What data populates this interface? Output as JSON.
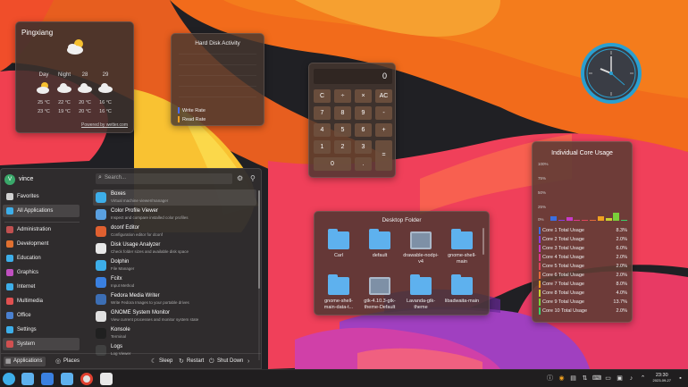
{
  "colors": {
    "accent": "#3daee9",
    "panel": "#463730",
    "write": "#4a6cf0",
    "read": "#f0a020"
  },
  "weather": {
    "city": "Pingxiang",
    "days": [
      {
        "label": "Day",
        "hi": "25 °C",
        "lo": "23 °C",
        "icon": "partly-sunny-icon"
      },
      {
        "label": "Night",
        "hi": "22 °C",
        "lo": "19 °C",
        "icon": "cloud-icon"
      },
      {
        "label": "28",
        "hi": "20 °C",
        "lo": "20 °C",
        "icon": "cloud-icon"
      },
      {
        "label": "29",
        "hi": "16 °C",
        "lo": "16 °C",
        "icon": "cloud-icon"
      }
    ],
    "powered": "Powered by wetter.com"
  },
  "disk": {
    "title": "Hard Disk Activity",
    "write_label": "Write Rate",
    "read_label": "Read Rate"
  },
  "calculator": {
    "display": "0",
    "keys": [
      "C",
      "÷",
      "×",
      "AC",
      "7",
      "8",
      "9",
      "-",
      "4",
      "5",
      "6",
      "+",
      "1",
      "2",
      "3",
      "=",
      "0",
      "."
    ]
  },
  "folder": {
    "title": "Desktop Folder",
    "items": [
      {
        "name": "Carl",
        "type": "folder"
      },
      {
        "name": "default",
        "type": "folder"
      },
      {
        "name": "drawable-nodpi-v4",
        "type": "image"
      },
      {
        "name": "gnome-shell-main",
        "type": "folder"
      },
      {
        "name": "gnome-shell-main-data-t...",
        "type": "folder"
      },
      {
        "name": "gtk-4.10.3-gtk-theme-Default",
        "type": "image"
      },
      {
        "name": "Lavanda-gtk-theme",
        "type": "folder"
      },
      {
        "name": "libadwaita-main",
        "type": "folder"
      }
    ]
  },
  "cores": {
    "title": "Individual Core Usage",
    "yticks": [
      "100%",
      "75%",
      "50%",
      "25%",
      "0%"
    ],
    "list": [
      {
        "name": "Core 1 Total Usage",
        "value": "8.3%",
        "pct": 8.3,
        "color": "#3b6fe0"
      },
      {
        "name": "Core 2 Total Usage",
        "value": "2.0%",
        "pct": 2.0,
        "color": "#8a3de0"
      },
      {
        "name": "Core 3 Total Usage",
        "value": "6.0%",
        "pct": 6.0,
        "color": "#c83ac8"
      },
      {
        "name": "Core 4 Total Usage",
        "value": "2.0%",
        "pct": 2.0,
        "color": "#e03a8a"
      },
      {
        "name": "Core 5 Total Usage",
        "value": "2.0%",
        "pct": 2.0,
        "color": "#e0455a"
      },
      {
        "name": "Core 6 Total Usage",
        "value": "2.0%",
        "pct": 2.0,
        "color": "#e06a3a"
      },
      {
        "name": "Core 7 Total Usage",
        "value": "8.0%",
        "pct": 8.0,
        "color": "#f0a020"
      },
      {
        "name": "Core 8 Total Usage",
        "value": "4.0%",
        "pct": 4.0,
        "color": "#c8d030"
      },
      {
        "name": "Core 9 Total Usage",
        "value": "13.7%",
        "pct": 13.7,
        "color": "#7ad03a"
      },
      {
        "name": "Core 10 Total Usage",
        "value": "2.0%",
        "pct": 2.0,
        "color": "#3ad06a"
      }
    ]
  },
  "launcher": {
    "user": "vince",
    "search_placeholder": "Search...",
    "avatar_letter": "V",
    "top_categories": [
      {
        "label": "Favorites",
        "color": "#d0d0d0"
      },
      {
        "label": "All Applications",
        "color": "#3daee9",
        "selected": true
      }
    ],
    "categories": [
      {
        "label": "Administration",
        "color": "#c05050"
      },
      {
        "label": "Development",
        "color": "#e07030"
      },
      {
        "label": "Education",
        "color": "#3daee9"
      },
      {
        "label": "Graphics",
        "color": "#c050c0"
      },
      {
        "label": "Internet",
        "color": "#3daee9"
      },
      {
        "label": "Multimedia",
        "color": "#e05050"
      },
      {
        "label": "Office",
        "color": "#4a80d0"
      },
      {
        "label": "Settings",
        "color": "#3daee9"
      },
      {
        "label": "System",
        "color": "#d05050"
      }
    ],
    "apps": [
      {
        "name": "Boxes",
        "desc": "Virtual machine viewer/manager",
        "color": "#3daee9",
        "selected": true
      },
      {
        "name": "Color Profile Viewer",
        "desc": "Inspect and compare installed color profiles",
        "color": "#5aa0e0"
      },
      {
        "name": "dconf Editor",
        "desc": "Configuration editor for dconf",
        "color": "#e06030"
      },
      {
        "name": "Disk Usage Analyzer",
        "desc": "Check folder sizes and available disk space",
        "color": "#e8e8e8"
      },
      {
        "name": "Dolphin",
        "desc": "File Manager",
        "color": "#3daee9"
      },
      {
        "name": "Fcitx",
        "desc": "Input Method",
        "color": "#3a80e0"
      },
      {
        "name": "Fedora Media Writer",
        "desc": "Write Fedora Images to your portable drives",
        "color": "#3c6eb4"
      },
      {
        "name": "GNOME System Monitor",
        "desc": "View current processes and monitor system state",
        "color": "#e0e0e0"
      },
      {
        "name": "Konsole",
        "desc": "Terminal",
        "color": "#202020"
      },
      {
        "name": "Logs",
        "desc": "Log Viewer",
        "color": "#404040"
      }
    ],
    "footer": {
      "applications": "Applications",
      "places": "Places",
      "sleep": "Sleep",
      "restart": "Restart",
      "shutdown": "Shut Down"
    }
  },
  "taskbar": {
    "time": "23:30",
    "date": "2023-09-27"
  }
}
